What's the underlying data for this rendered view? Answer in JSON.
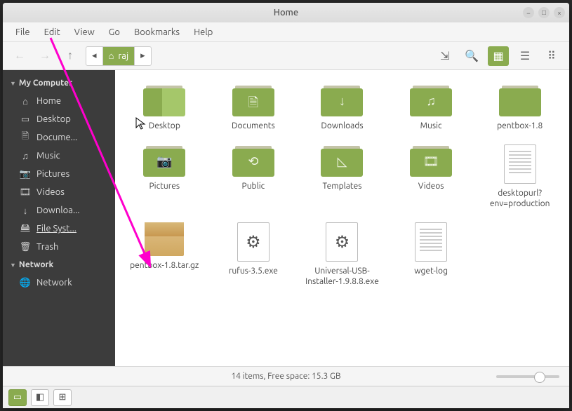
{
  "window": {
    "title": "Home"
  },
  "menubar": [
    "File",
    "Edit",
    "View",
    "Go",
    "Bookmarks",
    "Help"
  ],
  "path": {
    "current": "raj"
  },
  "sidebar": {
    "sections": [
      {
        "title": "My Computer",
        "items": [
          {
            "label": "Home",
            "icon": "home"
          },
          {
            "label": "Desktop",
            "icon": "desktop"
          },
          {
            "label": "Docume...",
            "icon": "doc"
          },
          {
            "label": "Music",
            "icon": "music"
          },
          {
            "label": "Pictures",
            "icon": "pic"
          },
          {
            "label": "Videos",
            "icon": "video"
          },
          {
            "label": "Downloa...",
            "icon": "download"
          },
          {
            "label": "File Syst...",
            "icon": "fs",
            "selected": true
          },
          {
            "label": "Trash",
            "icon": "trash"
          }
        ]
      },
      {
        "title": "Network",
        "items": [
          {
            "label": "Network",
            "icon": "network"
          }
        ]
      }
    ]
  },
  "items": [
    {
      "label": "Desktop",
      "type": "folder",
      "glyph": "",
      "class": "desktop-icon"
    },
    {
      "label": "Documents",
      "type": "folder",
      "glyph": "🗎"
    },
    {
      "label": "Downloads",
      "type": "folder",
      "glyph": "↓"
    },
    {
      "label": "Music",
      "type": "folder",
      "glyph": "♫"
    },
    {
      "label": "pentbox-1.8",
      "type": "folder",
      "glyph": ""
    },
    {
      "label": "Pictures",
      "type": "folder",
      "glyph": "📷"
    },
    {
      "label": "Public",
      "type": "folder",
      "glyph": "⟲"
    },
    {
      "label": "Templates",
      "type": "folder",
      "glyph": "◺"
    },
    {
      "label": "Videos",
      "type": "folder",
      "glyph": "🎞"
    },
    {
      "label": "desktopurl?env=production",
      "type": "textfile"
    },
    {
      "label": "pentbox-1.8.tar.gz",
      "type": "archive"
    },
    {
      "label": "rufus-3.5.exe",
      "type": "exe"
    },
    {
      "label": "Universal-USB-Installer-1.9.8.8.exe",
      "type": "exe"
    },
    {
      "label": "wget-log",
      "type": "textfile"
    }
  ],
  "status": "14 items, Free space: 15.3 GB",
  "icons": {
    "home": "⌂",
    "desktop": "▭",
    "doc": "🗎",
    "music": "♫",
    "pic": "📷",
    "video": "🎞",
    "download": "↓",
    "fs": "🖴",
    "trash": "🗑",
    "network": "🌐"
  }
}
